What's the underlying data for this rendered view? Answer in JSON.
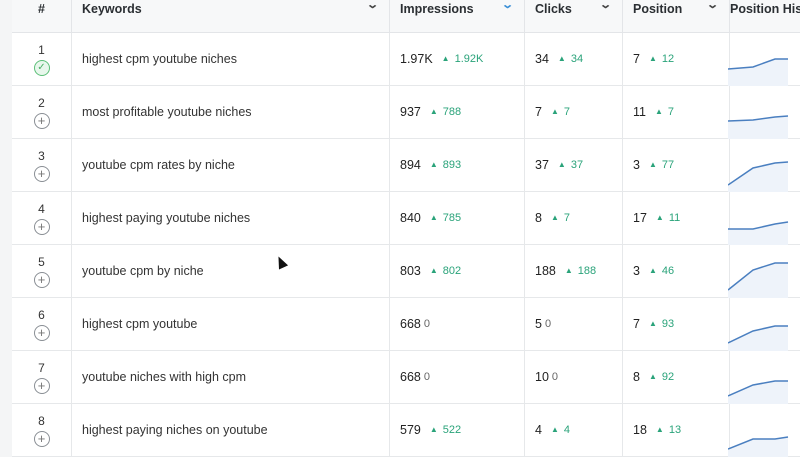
{
  "header": {
    "index": "#",
    "keywords": "Keywords",
    "impressions": "Impressions",
    "clicks": "Clicks",
    "position": "Position",
    "history": "Position His"
  },
  "colors": {
    "up": "#2aa37a",
    "sparkline": "#4a7fc0",
    "check": "#4aae66"
  },
  "rows": [
    {
      "index": "1",
      "status": "check-icon",
      "keyword": "highest cpm youtube niches",
      "impressions": "1.97K",
      "impressions_delta": "1.92K",
      "clicks": "34",
      "clicks_delta": "34",
      "position": "7",
      "position_delta": "12"
    },
    {
      "index": "2",
      "status": "plus-icon",
      "keyword": "most profitable youtube niches",
      "impressions": "937",
      "impressions_delta": "788",
      "clicks": "7",
      "clicks_delta": "7",
      "position": "11",
      "position_delta": "7"
    },
    {
      "index": "3",
      "status": "plus-icon",
      "keyword": "youtube cpm rates by niche",
      "impressions": "894",
      "impressions_delta": "893",
      "clicks": "37",
      "clicks_delta": "37",
      "position": "3",
      "position_delta": "77"
    },
    {
      "index": "4",
      "status": "plus-icon",
      "keyword": "highest paying youtube niches",
      "impressions": "840",
      "impressions_delta": "785",
      "clicks": "8",
      "clicks_delta": "7",
      "position": "17",
      "position_delta": "11"
    },
    {
      "index": "5",
      "status": "plus-icon",
      "keyword": "youtube cpm by niche",
      "impressions": "803",
      "impressions_delta": "802",
      "clicks": "188",
      "clicks_delta": "188",
      "position": "3",
      "position_delta": "46"
    },
    {
      "index": "6",
      "status": "plus-icon",
      "keyword": "highest cpm youtube",
      "impressions": "668",
      "impressions_delta": "0",
      "clicks": "5",
      "clicks_delta": "0",
      "position": "7",
      "position_delta": "93"
    },
    {
      "index": "7",
      "status": "plus-icon",
      "keyword": "youtube niches with high cpm",
      "impressions": "668",
      "impressions_delta": "0",
      "clicks": "10",
      "clicks_delta": "0",
      "position": "8",
      "position_delta": "92"
    },
    {
      "index": "8",
      "status": "plus-icon",
      "keyword": "highest paying niches on youtube",
      "impressions": "579",
      "impressions_delta": "522",
      "clicks": "4",
      "clicks_delta": "4",
      "position": "18",
      "position_delta": "13"
    }
  ]
}
